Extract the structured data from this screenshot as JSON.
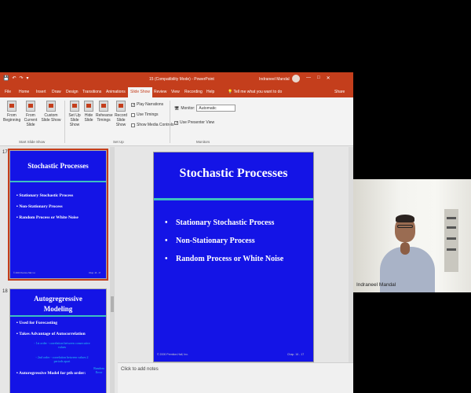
{
  "window": {
    "title": "15 (Compatibility Mode)  -  PowerPoint",
    "user": "Indraneel Mandal",
    "controls": [
      "—",
      "□",
      "✕"
    ],
    "quick_access": [
      "💾",
      "↶",
      "↷",
      "▾"
    ]
  },
  "ribbon_tabs": [
    "File",
    "Home",
    "Insert",
    "Draw",
    "Design",
    "Transitions",
    "Animations",
    "Slide Show",
    "Review",
    "View",
    "Recording",
    "Help"
  ],
  "active_tab": "Slide Show",
  "tell_me": "Tell me what you want to do",
  "share": "Share",
  "ribbon": {
    "from_beginning": "From Beginning",
    "from_current": "From Current Slide",
    "custom_show": "Custom Slide Show",
    "setup_show": "Set Up Slide Show",
    "hide_slide": "Hide Slide",
    "rehearse": "Rehearse Timings",
    "record": "Record Slide Show",
    "play_narrations": "Play Narrations",
    "use_timings": "Use Timings",
    "show_media_controls": "Show Media Controls",
    "monitor_label": "Monitor:",
    "monitor_value": "Automatic",
    "use_presenter_view": "Use Presenter View",
    "group_start": "Start Slide Show",
    "group_setup": "Set Up",
    "group_monitors": "Monitors"
  },
  "thumbnails": [
    {
      "number": "17",
      "title": "Stochastic Processes",
      "bullets": [
        "Stationary Stochastic Process",
        "Non-Stationary Process",
        "Random Process or White Noise"
      ],
      "footer_left": "© 2000 Prentice-Hall, Inc.",
      "footer_right": "Chap. 16 - 17"
    },
    {
      "number": "18",
      "title_line1": "Autogregressive",
      "title_line2": "Modeling",
      "bullets": [
        "Used for Forecasting",
        "Takes Advantage of Autocorrelation"
      ],
      "sub1_line1": "1st order - correlation between consecutive",
      "sub1_line2": "values",
      "sub2_line1": "2nd order - correlation between values 2",
      "sub2_line2": "periods apart",
      "bullet3": "Autoregressive Model for pth order:",
      "side_line1": "Random",
      "side_line2": "Error"
    }
  ],
  "slide": {
    "title": "Stochastic Processes",
    "bullets": [
      "Stationary Stochastic Process",
      "Non-Stationary Process",
      "Random Process or White Noise"
    ],
    "bullet_glyph": "•",
    "footer_left": "© 2000 Prentice-Hall, Inc.",
    "footer_right": "Chap. 16 - 17"
  },
  "notes_placeholder": "Click to add notes",
  "webcam": {
    "name": "Indraneel Mandal"
  },
  "colors": {
    "accent": "#c43e1c",
    "slide_bg": "#1414e6",
    "slide_bar": "#3dc0c0"
  }
}
